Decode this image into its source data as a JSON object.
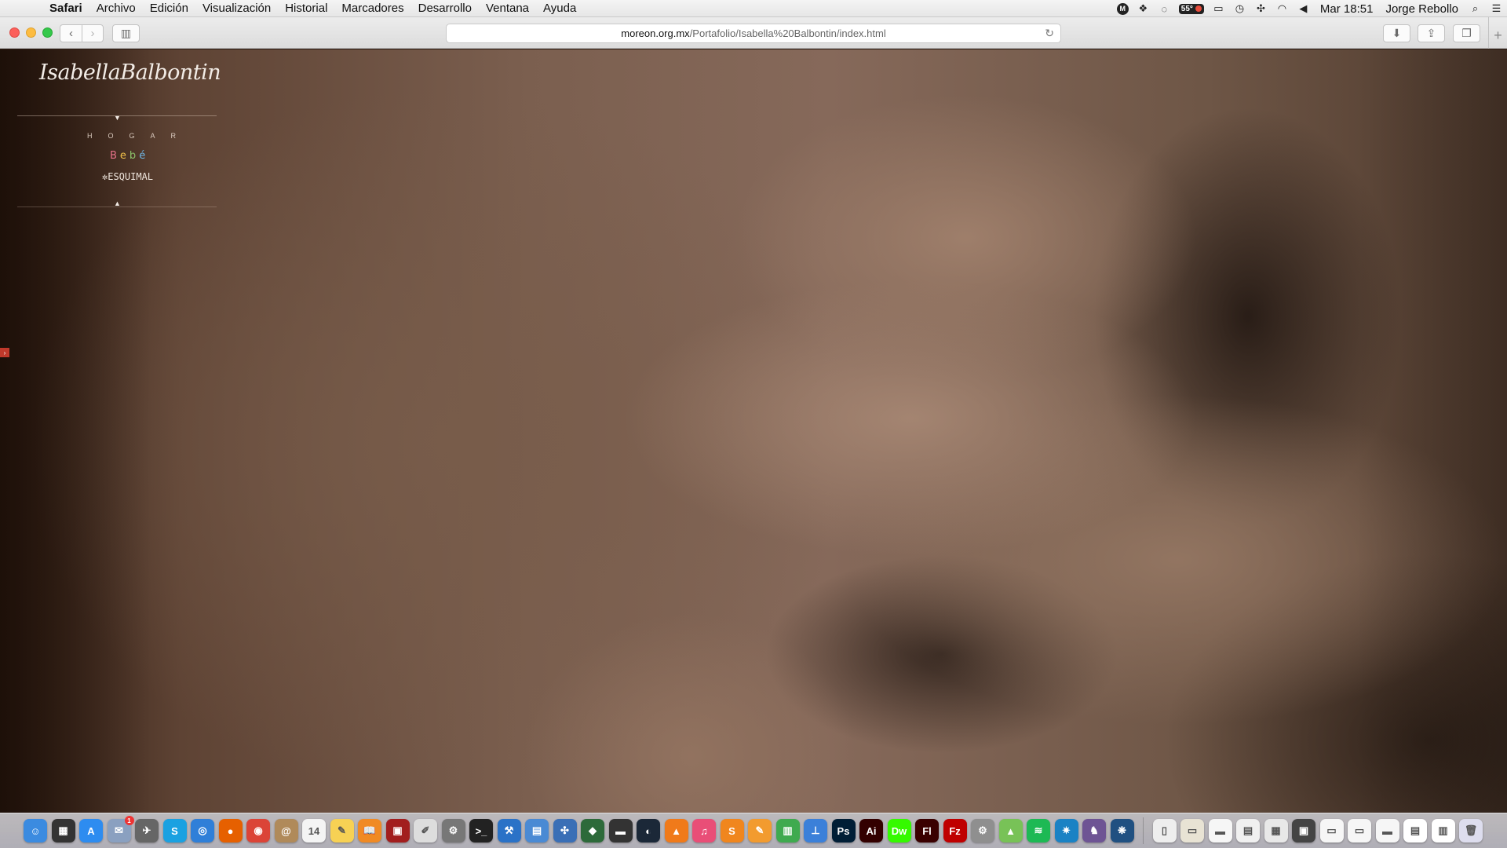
{
  "menubar": {
    "apple": "",
    "items": [
      "Safari",
      "Archivo",
      "Edición",
      "Visualización",
      "Historial",
      "Marcadores",
      "Desarrollo",
      "Ventana",
      "Ayuda"
    ],
    "status": {
      "temperature": "55°",
      "clock": "Mar 18:51",
      "user": "Jorge Rebollo"
    }
  },
  "toolbar": {
    "back": "‹",
    "forward": "›",
    "url_host": "moreon.org.mx",
    "url_path": "/Portafolio/Isabella%20Balbontin/index.html",
    "reload": "↻",
    "new_tab": "+"
  },
  "page": {
    "logo": "IsabellaBalbontin",
    "nav": {
      "hogar": "HOGAR",
      "bebe": [
        "B",
        "e",
        "b",
        "é"
      ],
      "esquimal": "✲ESQUIMAL"
    },
    "arrow_down": "▼",
    "arrow_up": "▲",
    "side_tab": "›"
  },
  "colors": {
    "page_background": "#6e5646",
    "bebe_letters": [
      "#e8728a",
      "#f0c04a",
      "#8cc36a",
      "#6fb6e4"
    ]
  },
  "dock": {
    "apps": [
      {
        "name": "finder",
        "glyph": "☺",
        "color": "#3b8be0"
      },
      {
        "name": "mission-control",
        "glyph": "▦",
        "color": "#333"
      },
      {
        "name": "app-store",
        "glyph": "A",
        "color": "#2d8cf0"
      },
      {
        "name": "mail-app",
        "glyph": "✉",
        "color": "#8aa0c0",
        "badge": "1"
      },
      {
        "name": "launchpad",
        "glyph": "✈",
        "color": "#666"
      },
      {
        "name": "skype",
        "glyph": "S",
        "color": "#1aa1e1"
      },
      {
        "name": "safari-app",
        "glyph": "◎",
        "color": "#2f7fd8"
      },
      {
        "name": "firefox",
        "glyph": "●",
        "color": "#e66000"
      },
      {
        "name": "chrome",
        "glyph": "◉",
        "color": "#db4437"
      },
      {
        "name": "contacts",
        "glyph": "@",
        "color": "#b08a5a"
      },
      {
        "name": "calendar",
        "glyph": "14",
        "color": "#f4f4f4"
      },
      {
        "name": "notes",
        "glyph": "✎",
        "color": "#f7d154"
      },
      {
        "name": "ibooks",
        "glyph": "📖",
        "color": "#f08a24"
      },
      {
        "name": "photo-booth",
        "glyph": "▣",
        "color": "#a21e1e"
      },
      {
        "name": "script-editor",
        "glyph": "✐",
        "color": "#ddd"
      },
      {
        "name": "system-preferences",
        "glyph": "⚙",
        "color": "#777"
      },
      {
        "name": "terminal",
        "glyph": ">_",
        "color": "#222"
      },
      {
        "name": "xcode",
        "glyph": "⚒",
        "color": "#2a72c7"
      },
      {
        "name": "preview",
        "glyph": "▤",
        "color": "#4a8ad4"
      },
      {
        "name": "network-utility",
        "glyph": "✣",
        "color": "#3a6fb6"
      },
      {
        "name": "vlc",
        "glyph": "◆",
        "color": "#2d6a3a"
      },
      {
        "name": "console",
        "glyph": "▬",
        "color": "#333"
      },
      {
        "name": "steam",
        "glyph": "◐",
        "color": "#1b2838"
      },
      {
        "name": "vlc-player",
        "glyph": "▲",
        "color": "#f07a1a"
      },
      {
        "name": "itunes",
        "glyph": "♫",
        "color": "#e94e77"
      },
      {
        "name": "sublime-text",
        "glyph": "S",
        "color": "#f0861e"
      },
      {
        "name": "pages",
        "glyph": "✎",
        "color": "#f29b2f"
      },
      {
        "name": "numbers",
        "glyph": "▥",
        "color": "#3faa4f"
      },
      {
        "name": "keynote",
        "glyph": "⊥",
        "color": "#3b80d9"
      },
      {
        "name": "photoshop",
        "glyph": "Ps",
        "color": "#001e36"
      },
      {
        "name": "illustrator",
        "glyph": "Ai",
        "color": "#330000"
      },
      {
        "name": "dreamweaver",
        "glyph": "Dw",
        "color": "#35fa00"
      },
      {
        "name": "flash",
        "glyph": "Fl",
        "color": "#3a0000"
      },
      {
        "name": "filezilla",
        "glyph": "Fz",
        "color": "#bf0000"
      },
      {
        "name": "automator",
        "glyph": "⚙",
        "color": "#8f8f8f"
      },
      {
        "name": "android-studio",
        "glyph": "▲",
        "color": "#78c257"
      },
      {
        "name": "spotify",
        "glyph": "≋",
        "color": "#1db954"
      },
      {
        "name": "sourcetree",
        "glyph": "✷",
        "color": "#1a82c4"
      },
      {
        "name": "github",
        "glyph": "♞",
        "color": "#6e5494"
      },
      {
        "name": "sourcetree-alt",
        "glyph": "❋",
        "color": "#205081"
      }
    ],
    "stacks": [
      {
        "name": "stack-1",
        "glyph": "▯",
        "color": "#eee"
      },
      {
        "name": "stack-2",
        "glyph": "▭",
        "color": "#e8e3d4"
      },
      {
        "name": "stack-3",
        "glyph": "▬",
        "color": "#f6f6f6"
      },
      {
        "name": "stack-4",
        "glyph": "▤",
        "color": "#f0f0f0"
      },
      {
        "name": "stack-5",
        "glyph": "▦",
        "color": "#e8e8e8"
      },
      {
        "name": "stack-6",
        "glyph": "▣",
        "color": "#444"
      },
      {
        "name": "stack-7",
        "glyph": "▭",
        "color": "#f6f6f6"
      },
      {
        "name": "stack-8",
        "glyph": "▭",
        "color": "#f6f6f6"
      },
      {
        "name": "stack-9",
        "glyph": "▬",
        "color": "#f6f6f6"
      },
      {
        "name": "stack-10",
        "glyph": "▤",
        "color": "#fff"
      },
      {
        "name": "stack-11",
        "glyph": "▥",
        "color": "#fff"
      },
      {
        "name": "trash",
        "glyph": "🗑",
        "color": "#dde"
      }
    ]
  }
}
